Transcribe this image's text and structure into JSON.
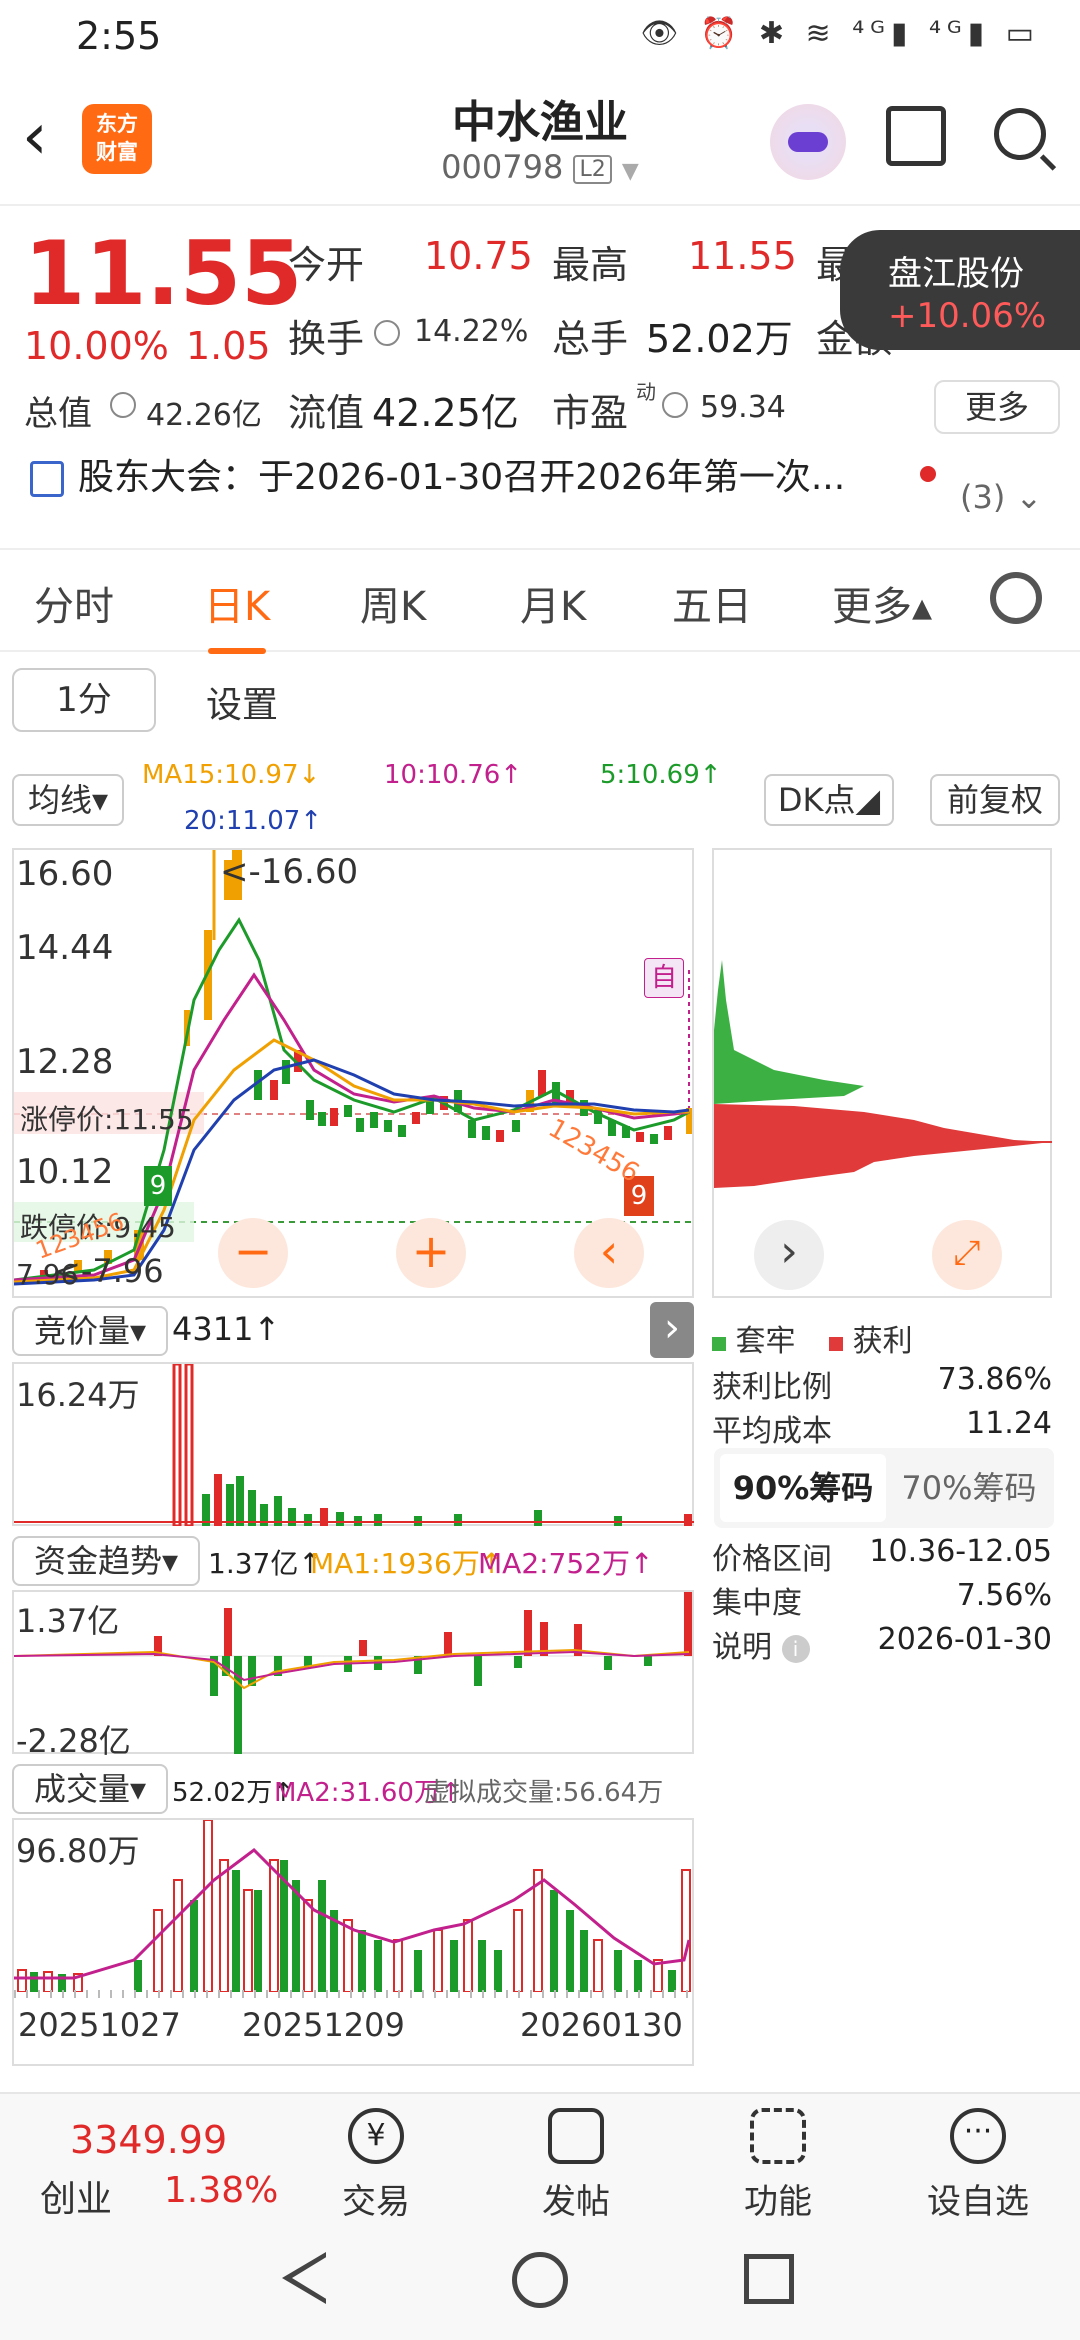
{
  "status": {
    "time": "2:55",
    "icons": "👁 ⏰ ✱ ≋ ⁴ᴳ▮ ⁴ᴳ▮ ▭"
  },
  "header": {
    "logo_line1": "东方",
    "logo_line2": "财富",
    "name": "中水渔业",
    "code": "000798",
    "level": "L2"
  },
  "quote": {
    "price": "11.55",
    "pct": "10.00%",
    "change": "1.05",
    "open_label": "今开",
    "open": "10.75",
    "high_label": "最高",
    "high": "11.55",
    "low_label_partial": "最",
    "turnover_label": "换手",
    "turnover": "14.22%",
    "volume_label": "总手",
    "volume": "52.02万",
    "amount_label_partial": "金额",
    "mktcap_label": "总值",
    "mktcap": "42.26亿",
    "float_label": "流值",
    "float_cap": "42.25亿",
    "pe_label": "市盈",
    "pe_sup": "动",
    "pe": "59.34",
    "more": "更多"
  },
  "floating": {
    "name": "盘江股份",
    "pct": "+10.06%"
  },
  "notice": {
    "text": "股东大会：于2026-01-30召开2026年第一次...",
    "count": "(3)"
  },
  "tabs": [
    "分时",
    "日K",
    "周K",
    "月K",
    "五日",
    "更多▴"
  ],
  "active_tab": "日K",
  "subbar": {
    "period": "1分",
    "settings": "设置"
  },
  "ma": {
    "selector": "均线▾",
    "ma15": "MA15:10.97↓",
    "ma10": "10:10.76↑",
    "ma5": "5:10.69↑",
    "ma20": "20:11.07↑",
    "dk": "DK点◢",
    "fq": "前复权"
  },
  "kchart": {
    "y_labels": [
      "16.60",
      "14.44",
      "12.28",
      "10.12",
      "7.96"
    ],
    "max_note": "<-16.60",
    "min_note": "<-7.96",
    "limit_up": "涨停价:11.55",
    "limit_down": "跌停价:9.45",
    "self_tag": "自",
    "nine_a": "9",
    "nine_b": "9",
    "seq": "123456"
  },
  "controls": {
    "minus": "−",
    "plus": "+",
    "left": "‹"
  },
  "auction": {
    "selector": "竞价量▾",
    "value": "4311↑",
    "max": "16.24万"
  },
  "fund": {
    "selector": "资金趋势▾",
    "value": "1.37亿↑",
    "ma1": "MA1:1936万↑",
    "ma2": "MA2:752万↑",
    "max": "1.37亿",
    "min": "-2.28亿"
  },
  "vol": {
    "selector": "成交量▾",
    "value": "52.02万↑",
    "ma2": "MA2:31.60万↑",
    "virtual": "虚拟成交量:56.64万",
    "max": "96.80万",
    "dates": [
      "20251027",
      "20251209",
      "20260130"
    ]
  },
  "chips": {
    "legend_trap": "套牢",
    "legend_profit": "获利",
    "profit_ratio_label": "获利比例",
    "profit_ratio": "73.86%",
    "avg_cost_label": "平均成本",
    "avg_cost": "11.24",
    "tab90": "90%筹码",
    "tab70": "70%筹码",
    "range_label": "价格区间",
    "range": "10.36-12.05",
    "concentration_label": "集中度",
    "concentration": "7.56%",
    "note_label": "说明",
    "note_icon": "i",
    "note_date": "2026-01-30"
  },
  "bottom": {
    "index_value": "3349.99",
    "index_name": "创业",
    "index_pct": "1.38%",
    "trade": "交易",
    "post": "发帖",
    "func": "功能",
    "watch": "设自选"
  },
  "colors": {
    "up": "#e02a2a",
    "down": "#1d9b2a",
    "accent": "#ff6a13",
    "ma5": "#1d9b2a",
    "ma10": "#c2208c",
    "ma15": "#f0a000",
    "ma20": "#2040b0"
  }
}
